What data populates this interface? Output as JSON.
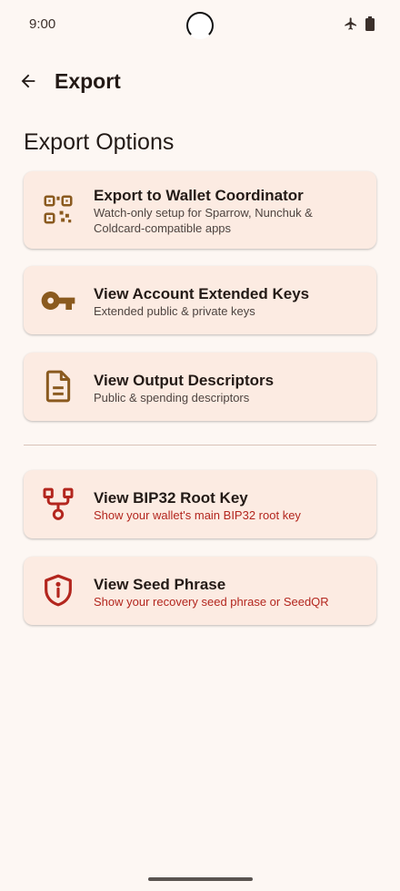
{
  "status_bar": {
    "time": "9:00",
    "icons": [
      "airplane-icon",
      "battery-icon"
    ]
  },
  "top_bar": {
    "back_icon": "arrow-left-icon",
    "title": "Export"
  },
  "section_title": "Export Options",
  "options": [
    {
      "icon": "qr-code-icon",
      "title": "Export to Wallet Coordinator",
      "subtitle": "Watch-only setup for Sparrow, Nunchuk & Coldcard-compatible apps",
      "warning": false
    },
    {
      "icon": "key-icon",
      "title": "View Account Extended Keys",
      "subtitle": "Extended public & private keys",
      "warning": false
    },
    {
      "icon": "document-icon",
      "title": "View Output Descriptors",
      "subtitle": "Public & spending descriptors",
      "warning": false
    },
    {
      "icon": "branch-icon",
      "title": "View BIP32 Root Key",
      "subtitle": "Show your wallet's main BIP32 root key",
      "warning": true
    },
    {
      "icon": "shield-alert-icon",
      "title": "View Seed Phrase",
      "subtitle": "Show your recovery seed phrase or SeedQR",
      "warning": true
    }
  ],
  "colors": {
    "background": "#fdf7f3",
    "card": "#fcebe2",
    "icon_brown": "#8a5a1f",
    "warning_red": "#b3261e"
  }
}
